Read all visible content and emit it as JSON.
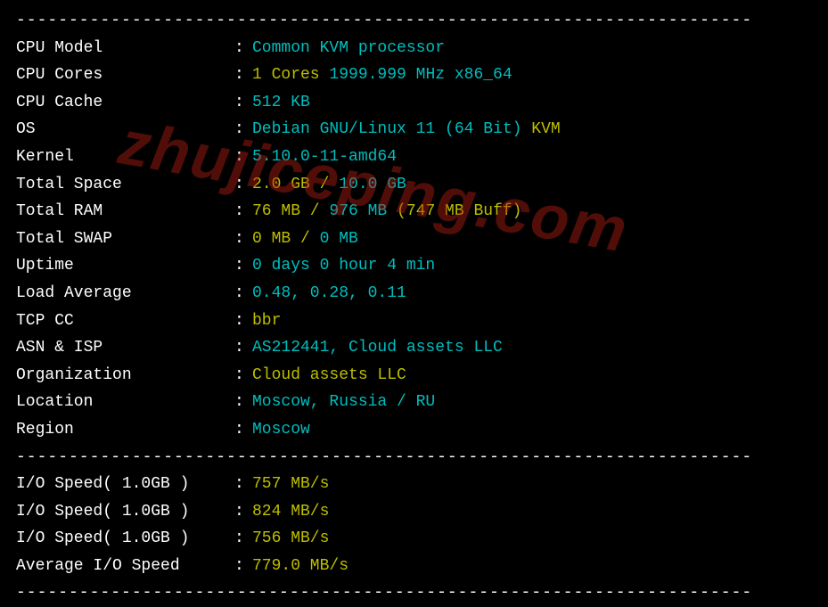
{
  "divider": "----------------------------------------------------------------------",
  "sysinfo": [
    {
      "label": "CPU Model",
      "parts": [
        {
          "c": "cyan",
          "t": "Common KVM processor"
        }
      ]
    },
    {
      "label": "CPU Cores",
      "parts": [
        {
          "c": "yellow",
          "t": "1 Cores"
        },
        {
          "c": "cyan",
          "t": " 1999.999 MHz x86_64"
        }
      ]
    },
    {
      "label": "CPU Cache",
      "parts": [
        {
          "c": "cyan",
          "t": "512 KB"
        }
      ]
    },
    {
      "label": "OS",
      "parts": [
        {
          "c": "cyan",
          "t": "Debian GNU/Linux 11 (64 Bit) "
        },
        {
          "c": "yellow",
          "t": "KVM"
        }
      ]
    },
    {
      "label": "Kernel",
      "parts": [
        {
          "c": "cyan",
          "t": "5.10.0-11-amd64"
        }
      ]
    },
    {
      "label": "Total Space",
      "parts": [
        {
          "c": "yellow",
          "t": "2.0 GB / "
        },
        {
          "c": "cyan",
          "t": "10.0 GB"
        }
      ]
    },
    {
      "label": "Total RAM",
      "parts": [
        {
          "c": "yellow",
          "t": "76 MB / "
        },
        {
          "c": "cyan",
          "t": "976 MB "
        },
        {
          "c": "yellow",
          "t": "(747 MB Buff)"
        }
      ]
    },
    {
      "label": "Total SWAP",
      "parts": [
        {
          "c": "yellow",
          "t": "0 MB / "
        },
        {
          "c": "cyan",
          "t": "0 MB"
        }
      ]
    },
    {
      "label": "Uptime",
      "parts": [
        {
          "c": "cyan",
          "t": "0 days 0 hour 4 min"
        }
      ]
    },
    {
      "label": "Load Average",
      "parts": [
        {
          "c": "cyan",
          "t": "0.48, 0.28, 0.11"
        }
      ]
    },
    {
      "label": "TCP CC",
      "parts": [
        {
          "c": "yellow",
          "t": "bbr"
        }
      ]
    },
    {
      "label": "ASN & ISP",
      "parts": [
        {
          "c": "cyan",
          "t": "AS212441, Cloud assets LLC"
        }
      ]
    },
    {
      "label": "Organization",
      "parts": [
        {
          "c": "yellow",
          "t": "Cloud assets LLC"
        }
      ]
    },
    {
      "label": "Location",
      "parts": [
        {
          "c": "cyan",
          "t": "Moscow, Russia / RU"
        }
      ]
    },
    {
      "label": "Region",
      "parts": [
        {
          "c": "cyan",
          "t": "Moscow"
        }
      ]
    }
  ],
  "iospeed": [
    {
      "label": "I/O Speed( 1.0GB )",
      "parts": [
        {
          "c": "yellow",
          "t": "757 MB/s"
        }
      ]
    },
    {
      "label": "I/O Speed( 1.0GB )",
      "parts": [
        {
          "c": "yellow",
          "t": "824 MB/s"
        }
      ]
    },
    {
      "label": "I/O Speed( 1.0GB )",
      "parts": [
        {
          "c": "yellow",
          "t": "756 MB/s"
        }
      ]
    },
    {
      "label": "Average I/O Speed",
      "parts": [
        {
          "c": "yellow",
          "t": "779.0 MB/s"
        }
      ]
    }
  ],
  "watermark": "zhujiceping.com"
}
